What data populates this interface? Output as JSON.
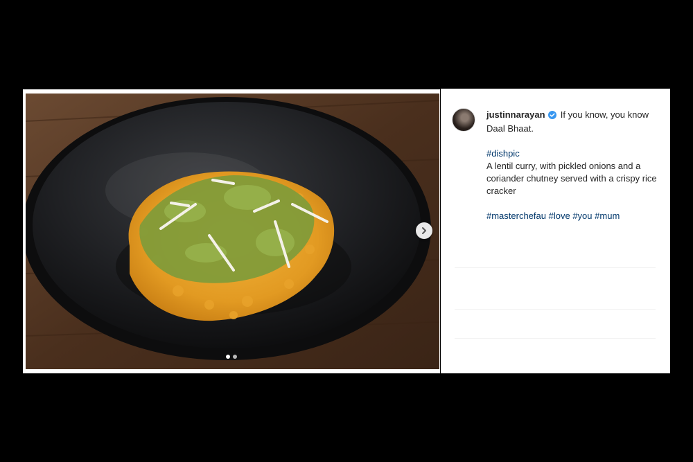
{
  "post": {
    "username": "justinnarayan",
    "caption_lead": "If you know, you know Daal Bhaat.",
    "hashtag_first": "#dishpic",
    "description": "A lentil curry, with pickled onions and a coriander chutney served with a crispy rice cracker",
    "hashtags": [
      "#masterchefau",
      "#love",
      "#you",
      "#mum"
    ]
  },
  "carousel": {
    "current_index": 1,
    "total": 2
  },
  "icons": {
    "verified": "verified-badge-icon",
    "next": "chevron-right-icon"
  },
  "colors": {
    "hashtag": "#00376b",
    "verified": "#3897f0",
    "text": "#262626"
  }
}
